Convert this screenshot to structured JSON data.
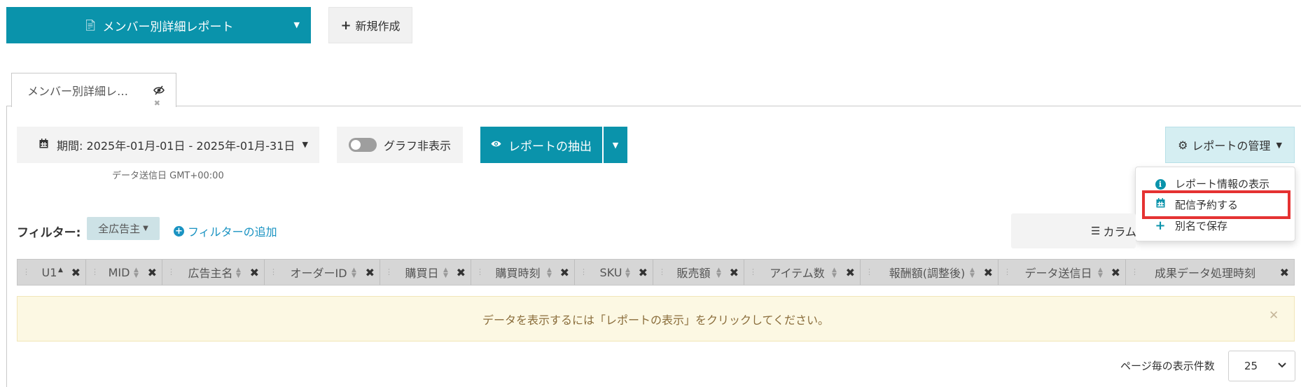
{
  "toolbar": {
    "report_select_label": "メンバー別詳細レポート",
    "new_button_label": "新規作成"
  },
  "tab": {
    "label": "メンバー別詳細レ…"
  },
  "controls": {
    "period_label": "期間: 2025年-01月-01日 - 2025年-01月-31日",
    "period_note": "データ送信日 GMT+00:00",
    "graph_toggle_label": "グラフ非表示",
    "graph_toggle_state": "off",
    "extract_button_label": "レポートの抽出",
    "manage_button_label": "レポートの管理"
  },
  "manage_menu": {
    "items": [
      {
        "label": "レポート情報の表示",
        "icon": "info-circle-icon"
      },
      {
        "label": "配信予約する",
        "icon": "calendar-icon"
      },
      {
        "label": "別名で保存",
        "icon": "plus-icon"
      }
    ],
    "highlighted_item": "配信予約する",
    "highlight_color": "#e53232"
  },
  "filter": {
    "label": "フィルター:",
    "advertiser_filter": "全広告主",
    "add_filter_label": "フィルターの追加",
    "column_button_label": "カラム"
  },
  "table": {
    "columns": [
      {
        "label": "U1",
        "sorted": "asc"
      },
      {
        "label": "MID"
      },
      {
        "label": "広告主名"
      },
      {
        "label": "オーダーID"
      },
      {
        "label": "購買日"
      },
      {
        "label": "購買時刻"
      },
      {
        "label": "SKU"
      },
      {
        "label": "販売額"
      },
      {
        "label": "アイテム数"
      },
      {
        "label": "報酬額(調整後)"
      },
      {
        "label": "データ送信日"
      },
      {
        "label": "成果データ処理時刻"
      }
    ]
  },
  "alert": {
    "message": "データを表示するには「レポートの表示」をクリックしてください。"
  },
  "pager": {
    "per_page_label": "ページ毎の表示件数",
    "per_page_value": "25"
  },
  "colors": {
    "primary": "#0a93ab",
    "manage_bg": "#d5eef2",
    "alert_bg": "#fcf8e3",
    "alert_text": "#8a6d3b",
    "link": "#1a93c2"
  }
}
